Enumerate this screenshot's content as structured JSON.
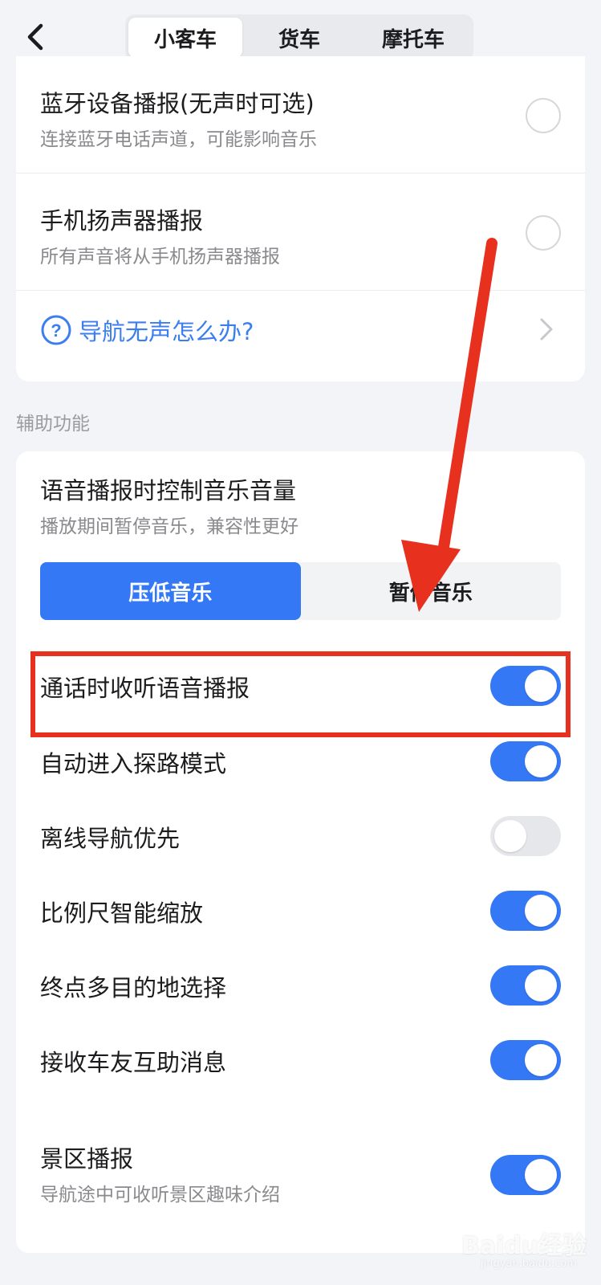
{
  "tabs": [
    {
      "label": "小客车",
      "active": true
    },
    {
      "label": "货车",
      "active": false
    },
    {
      "label": "摩托车",
      "active": false
    }
  ],
  "output_options": [
    {
      "title": "蓝牙设备播报(无声时可选)",
      "subtitle": "连接蓝牙电话声道，可能影响音乐",
      "selected": false
    },
    {
      "title": "手机扬声器播报",
      "subtitle": "所有声音将从手机扬声器播报",
      "selected": false
    }
  ],
  "help_link": "导航无声怎么办?",
  "section_label": "辅助功能",
  "music_control": {
    "title": "语音播报时控制音乐音量",
    "subtitle": "播放期间暂停音乐，兼容性更好",
    "options": [
      "压低音乐",
      "暂停音乐"
    ],
    "selected": "压低音乐"
  },
  "toggles": [
    {
      "label": "通话时收听语音播报",
      "on": true
    },
    {
      "label": "自动进入探路模式",
      "on": true
    },
    {
      "label": "离线导航优先",
      "on": false
    },
    {
      "label": "比例尺智能缩放",
      "on": true
    },
    {
      "label": "终点多目的地选择",
      "on": true
    },
    {
      "label": "接收车友互助消息",
      "on": true
    }
  ],
  "scenic": {
    "label": "景区播报",
    "subtitle": "导航途中可收听景区趣味介绍",
    "on": true
  },
  "watermark": {
    "brand": "Baidu经验",
    "url": "jingyan.baidu.com"
  },
  "colors": {
    "accent": "#3478f6",
    "annotation": "#e8301e"
  }
}
